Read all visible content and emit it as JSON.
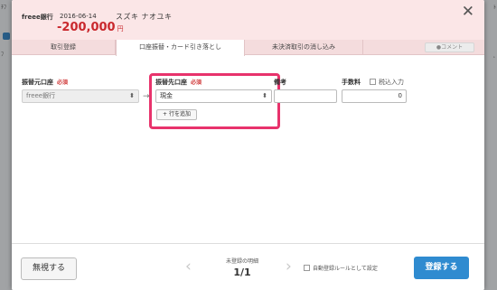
{
  "background": {
    "left_fragments": [
      "ﾁﾌ",
      "ﾌ"
    ],
    "right_fragments": [
      "ﾄ",
      "ﾟ"
    ]
  },
  "header": {
    "bank": "freee銀行",
    "date": "2016-06-14",
    "name": "スズキ ナオユキ",
    "amount": "-200,000",
    "amount_unit": "円",
    "close_icon": "close-icon"
  },
  "tabs": [
    {
      "label": "取引登録",
      "active": false
    },
    {
      "label": "口座振替・カード引き落とし",
      "active": true
    },
    {
      "label": "未決済取引の消し込み",
      "active": false
    }
  ],
  "comment_button": "コメント",
  "form": {
    "source_label": "振替元口座",
    "source_required": "必須",
    "source_value": "freee銀行",
    "dest_label": "振替先口座",
    "dest_required": "必須",
    "dest_value": "現金",
    "memo_label": "備考",
    "memo_value": "",
    "fee_label": "手数料",
    "tax_included_label": "税込入力",
    "fee_value": "0",
    "add_row_label": "行を追加",
    "arrow": "→"
  },
  "footer": {
    "ignore_label": "無視する",
    "unregistered_label": "未登録の明細",
    "page_count": "1/1",
    "prev_icon": "‹",
    "next_icon": "›",
    "auto_rule_label": "自動登録ルールとして設定",
    "register_label": "登録する"
  },
  "colors": {
    "header_bg": "#fbe6e7",
    "amount": "#c9282d",
    "highlight": "#e8336c",
    "primary_button": "#2f8bd0"
  }
}
